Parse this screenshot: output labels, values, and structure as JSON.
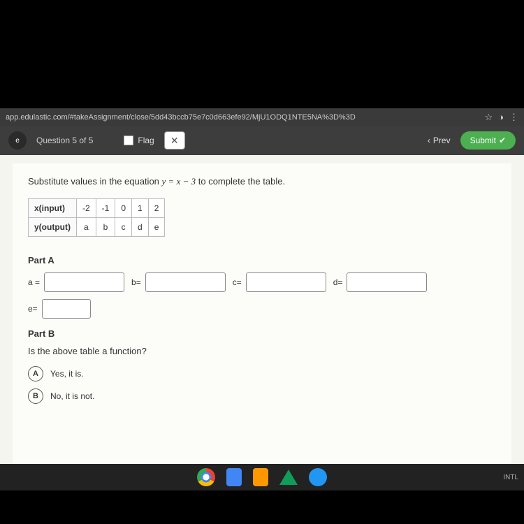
{
  "browser": {
    "url": "app.edulastic.com/#takeAssignment/close/5dd43bccb75e7c0d663efe92/MjU1ODQ1NTE5NA%3D%3D",
    "star_icon": "☆",
    "ext_icon": "◑",
    "menu_icon": "⋮"
  },
  "header": {
    "question_label": "Question 5 of 5",
    "flag_label": "Flag",
    "close_label": "✕",
    "prev_label": "Prev",
    "prev_arrow": "‹",
    "submit_label": "Submit",
    "submit_check": "✔"
  },
  "question": {
    "instruction_pre": "Substitute values in the equation ",
    "equation": "y = x − 3",
    "instruction_post": " to complete the table.",
    "table": {
      "row1_label": "x(input)",
      "row1_vals": [
        "-2",
        "-1",
        "0",
        "1",
        "2"
      ],
      "row2_label": "y(output)",
      "row2_vals": [
        "a",
        "b",
        "c",
        "d",
        "e"
      ]
    },
    "partA": {
      "label": "Part A",
      "fields": [
        "a =",
        "b=",
        "c=",
        "d=",
        "e="
      ]
    },
    "partB": {
      "label": "Part B",
      "question": "Is the above table a function?",
      "choices": [
        {
          "letter": "A",
          "text": "Yes, it is."
        },
        {
          "letter": "B",
          "text": "No, it is not."
        }
      ]
    }
  },
  "taskbar": {
    "intl": "INTL"
  }
}
